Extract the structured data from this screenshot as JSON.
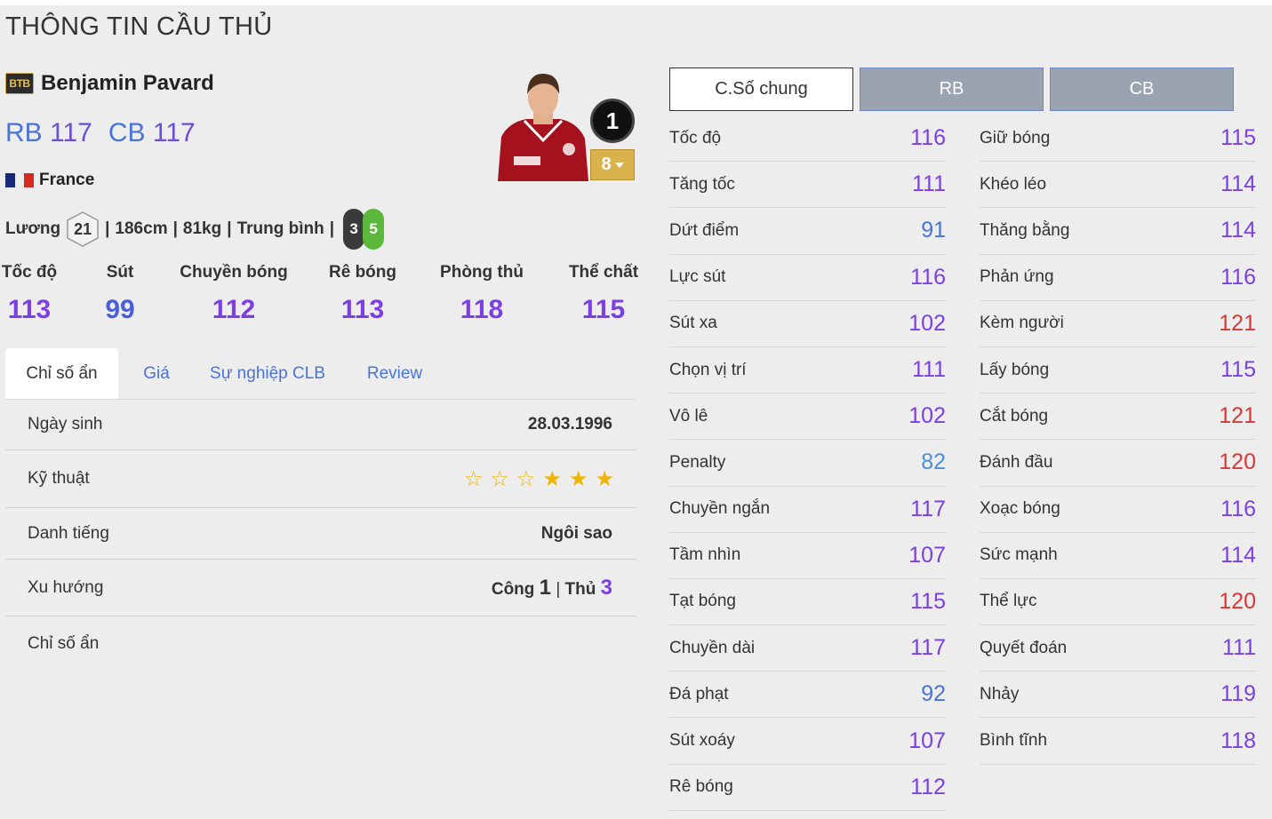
{
  "page_title": "THÔNG TIN CẦU THỦ",
  "player": {
    "season_badge": "BTB",
    "name": "Benjamin Pavard",
    "positions": [
      {
        "pos": "RB",
        "ovr": "117"
      },
      {
        "pos": "CB",
        "ovr": "117"
      }
    ],
    "nation": "France",
    "salary_label": "Lương",
    "salary": "21",
    "height": "186cm",
    "weight": "81kg",
    "body_type": "Trung bình",
    "weak_foot_left": "3",
    "weak_foot_right": "5",
    "rank": "1",
    "upgrade_level": "8"
  },
  "summary": [
    {
      "label": "Tốc độ",
      "value": "113"
    },
    {
      "label": "Sút",
      "value": "99"
    },
    {
      "label": "Chuyền bóng",
      "value": "112"
    },
    {
      "label": "Rê bóng",
      "value": "113"
    },
    {
      "label": "Phòng thủ",
      "value": "118"
    },
    {
      "label": "Thể chất",
      "value": "115"
    }
  ],
  "tabs": [
    "Chỉ số ẩn",
    "Giá",
    "Sự nghiệp CLB",
    "Review"
  ],
  "details": {
    "birthdate_label": "Ngày sinh",
    "birthdate": "28.03.1996",
    "skill_label": "Kỹ thuật",
    "skill_stars": 3,
    "skill_stars_max": 6,
    "reputation_label": "Danh tiếng",
    "reputation": "Ngôi sao",
    "trend_label": "Xu hướng",
    "trend_att_label": "Công",
    "trend_att": "1",
    "trend_sep": "|",
    "trend_def_label": "Thủ",
    "trend_def": "3",
    "hidden_label": "Chỉ số ẩn"
  },
  "position_tabs": [
    "C.Số chung",
    "RB",
    "CB"
  ],
  "stats_left": [
    {
      "name": "Tốc độ",
      "value": "116",
      "color": "#7b3fe4"
    },
    {
      "name": "Tăng tốc",
      "value": "111",
      "color": "#7b3fe4"
    },
    {
      "name": "Dứt điểm",
      "value": "91",
      "color": "#4a73d6"
    },
    {
      "name": "Lực sút",
      "value": "116",
      "color": "#7b3fe4"
    },
    {
      "name": "Sút xa",
      "value": "102",
      "color": "#7b3fe4"
    },
    {
      "name": "Chọn vị trí",
      "value": "111",
      "color": "#7b3fe4"
    },
    {
      "name": "Vô lê",
      "value": "102",
      "color": "#7b3fe4"
    },
    {
      "name": "Penalty",
      "value": "82",
      "color": "#4a90d6"
    },
    {
      "name": "Chuyền ngắn",
      "value": "117",
      "color": "#7b3fe4"
    },
    {
      "name": "Tầm nhìn",
      "value": "107",
      "color": "#7b3fe4"
    },
    {
      "name": "Tạt bóng",
      "value": "115",
      "color": "#7b3fe4"
    },
    {
      "name": "Chuyền dài",
      "value": "117",
      "color": "#7b3fe4"
    },
    {
      "name": "Đá phạt",
      "value": "92",
      "color": "#4a73d6"
    },
    {
      "name": "Sút xoáy",
      "value": "107",
      "color": "#7b3fe4"
    },
    {
      "name": "Rê bóng",
      "value": "112",
      "color": "#7b3fe4"
    }
  ],
  "stats_right": [
    {
      "name": "Giữ bóng",
      "value": "115",
      "color": "#7b3fe4"
    },
    {
      "name": "Khéo léo",
      "value": "114",
      "color": "#7b3fe4"
    },
    {
      "name": "Thăng bằng",
      "value": "114",
      "color": "#7b3fe4"
    },
    {
      "name": "Phản ứng",
      "value": "116",
      "color": "#7b3fe4"
    },
    {
      "name": "Kèm người",
      "value": "121",
      "color": "#d93636"
    },
    {
      "name": "Lấy bóng",
      "value": "115",
      "color": "#7b3fe4"
    },
    {
      "name": "Cắt bóng",
      "value": "121",
      "color": "#d93636"
    },
    {
      "name": "Đánh đầu",
      "value": "120",
      "color": "#d93636"
    },
    {
      "name": "Xoạc bóng",
      "value": "116",
      "color": "#7b3fe4"
    },
    {
      "name": "Sức mạnh",
      "value": "114",
      "color": "#7b3fe4"
    },
    {
      "name": "Thể lực",
      "value": "120",
      "color": "#d93636"
    },
    {
      "name": "Quyết đoán",
      "value": "111",
      "color": "#7b3fe4"
    },
    {
      "name": "Nhảy",
      "value": "119",
      "color": "#7b3fe4"
    },
    {
      "name": "Bình tĩnh",
      "value": "118",
      "color": "#7b3fe4"
    }
  ]
}
